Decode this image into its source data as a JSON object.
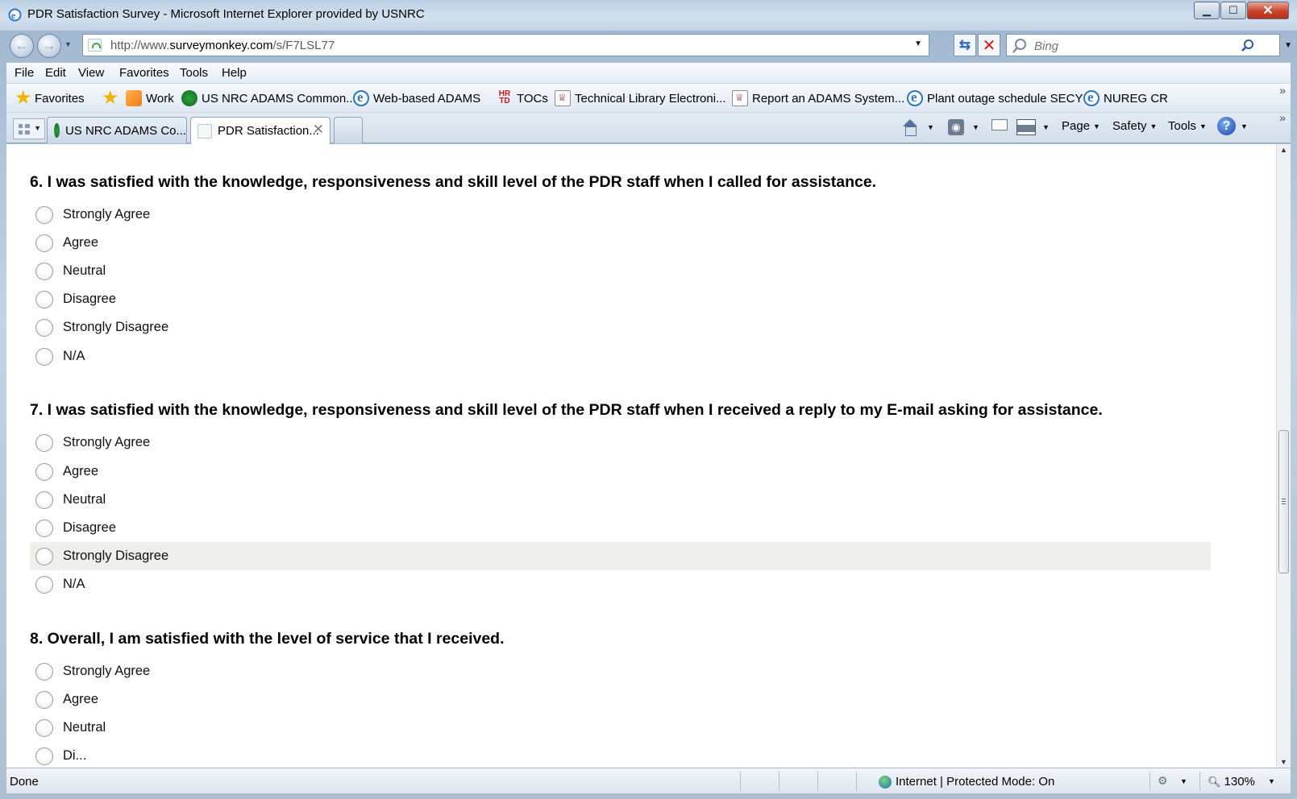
{
  "window": {
    "title": "PDR Satisfaction Survey - Microsoft Internet Explorer provided by USNRC",
    "minimize": "▁",
    "maximize": "☐",
    "close": "✕"
  },
  "address": {
    "url_prefix": "http://www.",
    "url_domain": "surveymonkey.com",
    "url_path": "/s/F7LSL77",
    "search_placeholder": "Bing"
  },
  "menu": [
    "File",
    "Edit",
    "View",
    "Favorites",
    "Tools",
    "Help"
  ],
  "favorites_bar": {
    "favorites_label": "Favorites",
    "items": [
      {
        "label": "Work",
        "icon": "work-icon"
      },
      {
        "label": "US NRC ADAMS Common...",
        "icon": "nrc-icon"
      },
      {
        "label": "Web-based ADAMS",
        "icon": "ie-page-icon"
      },
      {
        "label": "TOCs",
        "icon": "hrtd-icon"
      },
      {
        "label": "Technical Library Electroni...",
        "icon": "nrc-doc-icon"
      },
      {
        "label": "Report an ADAMS System...",
        "icon": "nrc-doc-icon"
      },
      {
        "label": "Plant outage schedule SECY",
        "icon": "ie-page-icon"
      },
      {
        "label": "NUREG CR",
        "icon": "ie-page-icon"
      }
    ],
    "hrtd_line1": "HR",
    "hrtd_line2": "TD"
  },
  "tabs": [
    {
      "label": "US NRC ADAMS Co...",
      "active": false
    },
    {
      "label": "PDR Satisfaction...",
      "active": true
    }
  ],
  "command_bar": {
    "page": "Page",
    "safety": "Safety",
    "tools": "Tools",
    "help": "?"
  },
  "survey": {
    "questions": [
      {
        "text": "6. I was satisfied with the knowledge, responsiveness and skill level of the PDR staff when I called for assistance.",
        "options": [
          "Strongly Agree",
          "Agree",
          "Neutral",
          "Disagree",
          "Strongly Disagree",
          "N/A"
        ]
      },
      {
        "text": "7. I was satisfied with the knowledge, responsiveness and skill level of the PDR staff when I received a reply to my E-mail asking for assistance.",
        "options": [
          "Strongly Agree",
          "Agree",
          "Neutral",
          "Disagree",
          "Strongly Disagree",
          "N/A"
        ]
      },
      {
        "text": "8. Overall, I am satisfied with the level of service that I received.",
        "options": [
          "Strongly Agree",
          "Agree",
          "Neutral",
          "Di..."
        ]
      }
    ]
  },
  "status_bar": {
    "status": "Done",
    "zone": "Internet | Protected Mode: On",
    "zoom": "130%"
  }
}
